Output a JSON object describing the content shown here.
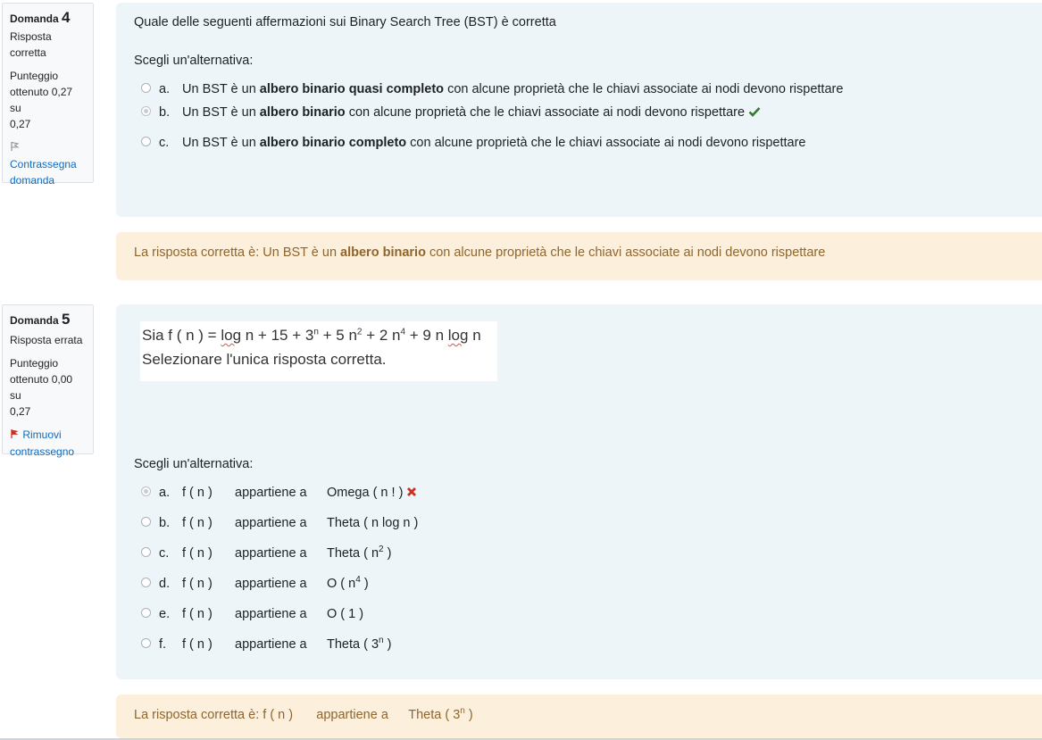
{
  "q4": {
    "label": "Domanda",
    "number": "4",
    "state_line1": "Risposta",
    "state_line2": "corretta",
    "grade_line1": "Punteggio",
    "grade_line2": "ottenuto 0,27 su",
    "grade_line3": "0,27",
    "flag_line1": "Contrassegna",
    "flag_line2": "domanda",
    "question": "Quale delle seguenti affermazioni sui Binary Search Tree (BST) è corretta",
    "prompt": "Scegli un'alternativa:",
    "options": [
      {
        "letter": "a.",
        "pre": "Un BST è un ",
        "bold": "albero binario quasi completo",
        "post": " con alcune proprietà che le chiavi associate ai nodi devono rispettare"
      },
      {
        "letter": "b.",
        "pre": "Un BST è un ",
        "bold": "albero binario",
        "post": " con alcune proprietà che le chiavi associate ai nodi devono rispettare"
      },
      {
        "letter": "c.",
        "pre": "Un BST è un ",
        "bold": "albero binario completo",
        "post": " con alcune proprietà che le chiavi associate ai nodi devono rispettare"
      }
    ],
    "feedback_pre": "La risposta corretta è: Un BST è un ",
    "feedback_bold": "albero binario",
    "feedback_post": " con alcune proprietà che le chiavi associate ai nodi devono rispettare"
  },
  "q5": {
    "label": "Domanda",
    "number": "5",
    "state": "Risposta errata",
    "grade_line1": "Punteggio",
    "grade_line2": "ottenuto 0,00 su",
    "grade_line3": "0,27",
    "flag_line1": "Rimuovi",
    "flag_line2": "contrassegno",
    "math_prefix": "Sia f ( n ) = ",
    "math_log1": "log",
    "math_mid": " n + 15 + 3",
    "math_sup1": "n",
    "math_mid2": " + 5 n",
    "math_sup2": "2",
    "math_mid3": " + 2 n",
    "math_sup3": "4",
    "math_mid4": " + 9 n ",
    "math_log2": "log",
    "math_end": " n",
    "math_line2": "Selezionare l'unica risposta corretta.",
    "prompt": "Scegli un'alternativa:",
    "fn": "f ( n )",
    "belongs": "appartiene a",
    "options": [
      {
        "letter": "a.",
        "answer": "Omega ( n ! )"
      },
      {
        "letter": "b.",
        "answer": "Theta ( n log n )"
      },
      {
        "letter": "c.",
        "answer_pre": "Theta ( n",
        "answer_sup": "2",
        "answer_post": " )"
      },
      {
        "letter": "d.",
        "answer_pre": "O ( n",
        "answer_sup": "4",
        "answer_post": " )"
      },
      {
        "letter": "e.",
        "answer": "O ( 1 )"
      },
      {
        "letter": "f.",
        "answer_pre": "Theta ( 3",
        "answer_sup": "n",
        "answer_post": " )"
      }
    ],
    "feedback_pre": "La risposta corretta è: ",
    "feedback_fn": "f ( n )",
    "feedback_belongs": "appartiene a",
    "feedback_ans_pre": "Theta ( 3",
    "feedback_ans_sup": "n",
    "feedback_ans_post": " )"
  },
  "icons": {
    "correct": "check-icon",
    "incorrect": "cross-icon",
    "flag_empty": "flag-outline-icon",
    "flag_set": "flag-red-icon"
  },
  "colors": {
    "question_bg": "#edf5f9",
    "feedback_bg": "#fcefdc",
    "feedback_text": "#8e662e",
    "link": "#0f6cbf",
    "correct": "#357a32",
    "incorrect": "#ca3120"
  }
}
